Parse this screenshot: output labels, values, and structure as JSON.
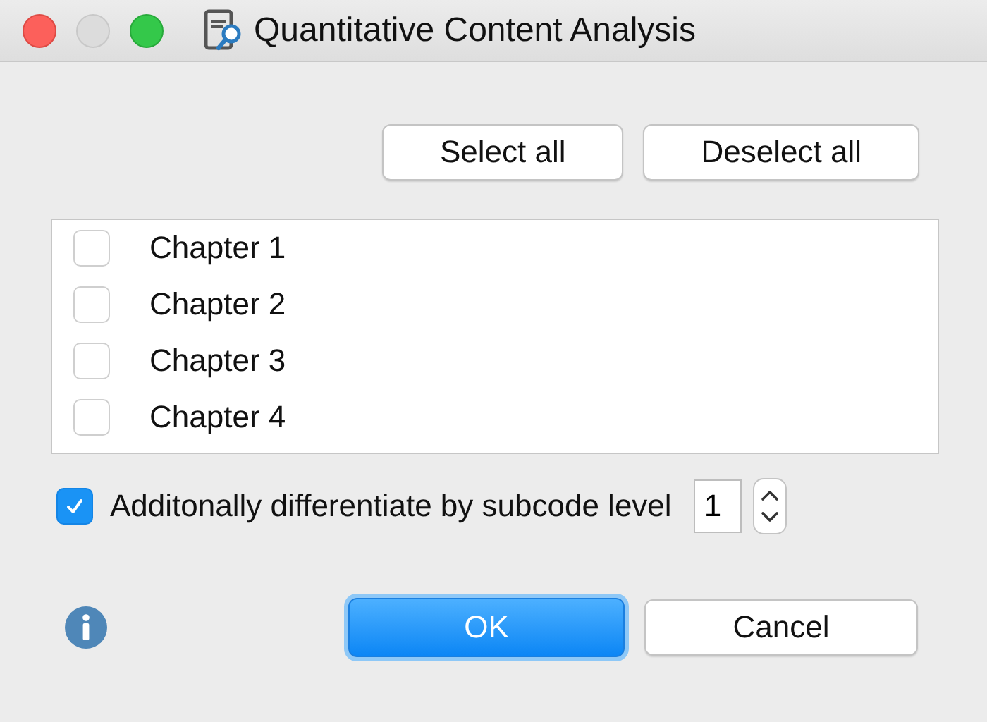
{
  "window": {
    "title": "Quantitative Content Analysis"
  },
  "top_buttons": [
    "Select all",
    "Deselect all"
  ],
  "items": [
    {
      "label": "Chapter 1",
      "checked": false
    },
    {
      "label": "Chapter 2",
      "checked": false
    },
    {
      "label": "Chapter 3",
      "checked": false
    },
    {
      "label": "Chapter 4",
      "checked": false
    }
  ],
  "subcode_option": {
    "label": "Additonally differentiate by subcode level",
    "checked": true,
    "value": "1"
  },
  "buttons": [
    {
      "label": "OK",
      "kind": "default"
    },
    {
      "label": "Cancel",
      "kind": "normal"
    }
  ]
}
